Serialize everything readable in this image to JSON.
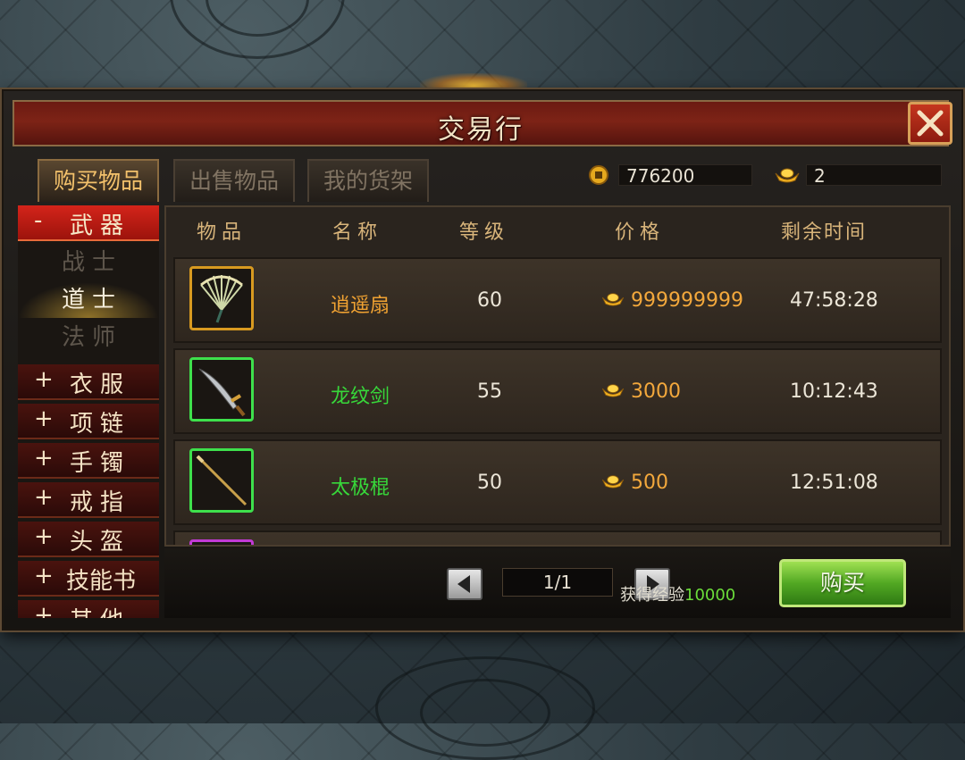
{
  "window": {
    "title": "交易行"
  },
  "tabs": [
    {
      "label": "购买物品",
      "active": true
    },
    {
      "label": "出售物品",
      "active": false
    },
    {
      "label": "我的货架",
      "active": false
    }
  ],
  "currency": {
    "coins": "776200",
    "ingots": "2"
  },
  "categories": [
    {
      "sign": "-",
      "label": "武器",
      "expanded": true,
      "subitems": [
        {
          "label": "战士",
          "selected": false
        },
        {
          "label": "道士",
          "selected": true
        },
        {
          "label": "法师",
          "selected": false
        }
      ]
    },
    {
      "sign": "+",
      "label": "衣服"
    },
    {
      "sign": "+",
      "label": "项链"
    },
    {
      "sign": "+",
      "label": "手镯"
    },
    {
      "sign": "+",
      "label": "戒指"
    },
    {
      "sign": "+",
      "label": "头盔"
    },
    {
      "sign": "+",
      "label": "技能书"
    },
    {
      "sign": "+",
      "label": "其他"
    }
  ],
  "table": {
    "headers": [
      "物品",
      "名称",
      "等级",
      "价格",
      "剩余时间"
    ],
    "rows": [
      {
        "icon": "fan-icon",
        "name": "逍遥扇",
        "name_color": "#f0a232",
        "level": "60",
        "price": "999999999",
        "time": "47:58:28",
        "rarity": "gold"
      },
      {
        "icon": "sword-icon",
        "name": "龙纹剑",
        "name_color": "#37d83a",
        "level": "55",
        "price": "3000",
        "time": "10:12:43",
        "rarity": "green"
      },
      {
        "icon": "staff-icon",
        "name": "太极棍",
        "name_color": "#37d83a",
        "level": "50",
        "price": "500",
        "time": "12:51:08",
        "rarity": "green"
      }
    ]
  },
  "pagination": {
    "page": "1/1"
  },
  "exp": {
    "label": "获得经验",
    "value": "10000"
  },
  "buy_label": "购买"
}
